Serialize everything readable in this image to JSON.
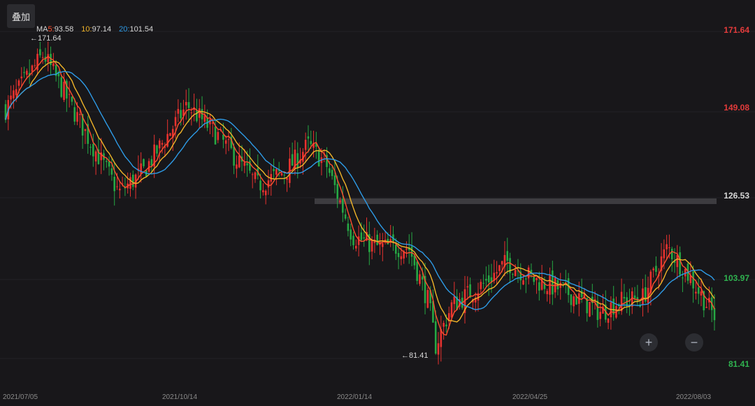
{
  "toolbar": {
    "overlay_label": "叠加"
  },
  "legend": {
    "ma_prefix": "MA",
    "ma5_label": "5:",
    "ma5_value": "93.58",
    "ma10_label": "10:",
    "ma10_value": "97.14",
    "ma20_label": "20:",
    "ma20_value": "101.54"
  },
  "price_axis": {
    "labels": [
      {
        "text": "171.64",
        "color": "#e23b3b"
      },
      {
        "text": "149.08",
        "color": "#e23b3b"
      },
      {
        "text": "126.53",
        "color": "#d6d6d6"
      },
      {
        "text": "103.97",
        "color": "#2fb24f"
      },
      {
        "text": "81.41",
        "color": "#2fb24f"
      }
    ]
  },
  "date_axis": {
    "labels": [
      "2021/07/05",
      "2021/10/14",
      "2022/01/14",
      "2022/04/25",
      "2022/08/03"
    ]
  },
  "annotations": {
    "high_label": "171.64",
    "low_label": "81.41",
    "arrow": "←"
  },
  "controls": {
    "zoom_in": "+",
    "zoom_out": "−"
  },
  "colors": {
    "up": "#e8322f",
    "down": "#26a844",
    "ma5": "#ff4f2e",
    "ma10": "#f0b429",
    "ma20": "#2e9be6",
    "current_price_band": "#4a4a4e"
  },
  "chart_data": {
    "type": "candlestick",
    "x_range": [
      "2021/07/05",
      "2022/08/03"
    ],
    "ylim": [
      81.41,
      171.64
    ],
    "high": 171.64,
    "low": 81.41,
    "current_price_band": 126.53,
    "key_points": [
      {
        "date": "2021/07/05",
        "close": 150
      },
      {
        "date": "2021/07/26",
        "close": 165
      },
      {
        "date": "2021/08/20",
        "close": 142
      },
      {
        "date": "2021/09/06",
        "close": 127
      },
      {
        "date": "2021/09/20",
        "close": 133
      },
      {
        "date": "2021/10/14",
        "close": 151
      },
      {
        "date": "2021/11/01",
        "close": 142
      },
      {
        "date": "2021/11/22",
        "close": 129
      },
      {
        "date": "2021/12/08",
        "close": 133
      },
      {
        "date": "2021/12/20",
        "close": 140
      },
      {
        "date": "2021/12/30",
        "close": 135
      },
      {
        "date": "2022/01/14",
        "close": 115
      },
      {
        "date": "2022/01/28",
        "close": 112
      },
      {
        "date": "2022/02/14",
        "close": 112
      },
      {
        "date": "2022/02/25",
        "close": 97
      },
      {
        "date": "2022/03/01",
        "close": 85
      },
      {
        "date": "2022/03/10",
        "close": 96
      },
      {
        "date": "2022/03/28",
        "close": 102
      },
      {
        "date": "2022/04/10",
        "close": 108
      },
      {
        "date": "2022/04/25",
        "close": 103
      },
      {
        "date": "2022/05/12",
        "close": 100
      },
      {
        "date": "2022/06/01",
        "close": 94
      },
      {
        "date": "2022/06/10",
        "close": 97
      },
      {
        "date": "2022/06/24",
        "close": 98
      },
      {
        "date": "2022/07/08",
        "close": 112
      },
      {
        "date": "2022/07/20",
        "close": 104
      },
      {
        "date": "2022/08/03",
        "close": 93
      }
    ],
    "moving_averages": [
      {
        "name": "MA5",
        "last": 93.58
      },
      {
        "name": "MA10",
        "last": 97.14
      },
      {
        "name": "MA20",
        "last": 101.54
      }
    ]
  }
}
